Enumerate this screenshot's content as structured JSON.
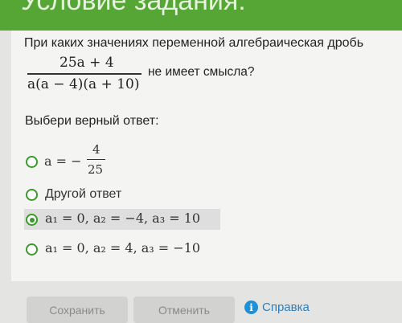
{
  "header": {
    "title": "Условие задания:"
  },
  "question": {
    "text_before": "При каких значениях переменной алгебраическая дробь",
    "fraction_numerator": "25a + 4",
    "fraction_denominator": "a(a − 4)(a + 10)",
    "text_after": "не имеет смысла?"
  },
  "prompt": "Выбери верный ответ:",
  "options": [
    {
      "prefix": "a = −",
      "numerator": "4",
      "denominator": "25",
      "selected": false
    },
    {
      "text": "Другой ответ",
      "selected": false
    },
    {
      "text": "a₁ = 0, a₂ = −4,  a₃ = 10",
      "selected": true
    },
    {
      "text": "a₁ = 0, a₂ = 4,  a₃ = −10",
      "selected": false
    }
  ],
  "buttons": {
    "save": "Сохранить",
    "cancel": "Отменить",
    "help": "Справка"
  },
  "colors": {
    "header": "#55a634",
    "radio": "#3a9a2a",
    "help_link": "#2c7fbf"
  }
}
